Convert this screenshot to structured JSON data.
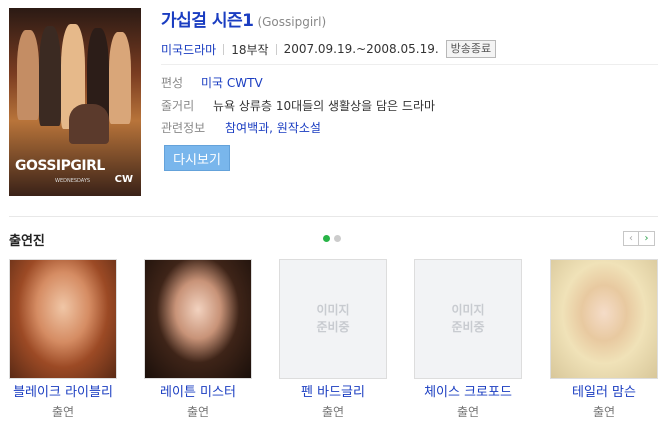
{
  "header": {
    "title": "가십걸 시즌1",
    "original_title": "(Gossipgirl)"
  },
  "meta": {
    "genre": "미국드라마",
    "episodes": "18부작",
    "period": "2007.09.19.~2008.05.19.",
    "status": "방송종료"
  },
  "info": [
    {
      "label": "편성",
      "value": "미국 CWTV"
    },
    {
      "label": "줄거리",
      "value": "뉴욕 상류층 10대들의 생활상을 담은 드라마"
    },
    {
      "label": "관련정보",
      "value": "참여백과, 원작소설"
    }
  ],
  "poster": {
    "art_title": "GOSSIPGIRL",
    "art_sub": "WEDNESDAYS",
    "art_network": "CW"
  },
  "replay_button": "다시보기",
  "cast_section": {
    "title": "출연진",
    "members": [
      {
        "name": "블레이크 라이블리",
        "role": "출연",
        "has_photo": true
      },
      {
        "name": "레이튼 미스터",
        "role": "출연",
        "has_photo": true
      },
      {
        "name": "펜 바드글리",
        "role": "출연",
        "has_photo": false,
        "placeholder": "이미지 준비중"
      },
      {
        "name": "체이스 크로포드",
        "role": "출연",
        "has_photo": false,
        "placeholder": "이미지 준비중"
      },
      {
        "name": "테일러 맘슨",
        "role": "출연",
        "has_photo": true
      }
    ]
  },
  "colors": {
    "link": "#1a3dc1",
    "button": "#79b6ec",
    "active_dot": "#28b447"
  },
  "icons": [
    "chevron-left-icon",
    "chevron-right-icon"
  ]
}
